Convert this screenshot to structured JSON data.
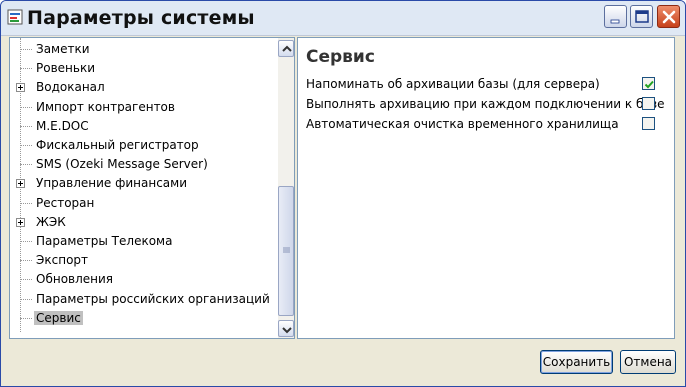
{
  "window": {
    "title": "Параметры системы"
  },
  "tree": {
    "items": [
      {
        "label": "Заметки",
        "expandable": false,
        "selected": false
      },
      {
        "label": "Ровеньки",
        "expandable": false,
        "selected": false
      },
      {
        "label": "Водоканал",
        "expandable": true,
        "selected": false
      },
      {
        "label": "Импорт контрагентов",
        "expandable": false,
        "selected": false
      },
      {
        "label": "M.E.DOC",
        "expandable": false,
        "selected": false
      },
      {
        "label": "Фискальный регистратор",
        "expandable": false,
        "selected": false
      },
      {
        "label": "SMS (Ozeki Message Server)",
        "expandable": false,
        "selected": false
      },
      {
        "label": "Управление финансами",
        "expandable": true,
        "selected": false
      },
      {
        "label": "Ресторан",
        "expandable": false,
        "selected": false
      },
      {
        "label": "ЖЭК",
        "expandable": true,
        "selected": false
      },
      {
        "label": "Параметры Телекома",
        "expandable": false,
        "selected": false
      },
      {
        "label": "Экспорт",
        "expandable": false,
        "selected": false
      },
      {
        "label": "Обновления",
        "expandable": false,
        "selected": false
      },
      {
        "label": "Параметры российских организаций",
        "expandable": false,
        "selected": false
      },
      {
        "label": "Сервис",
        "expandable": false,
        "selected": true
      }
    ]
  },
  "panel": {
    "title": "Сервис",
    "options": [
      {
        "label": "Напоминать об архивации базы (для сервера)",
        "checked": true
      },
      {
        "label": "Выполнять архивацию при каждом подключении к базе",
        "checked": false
      },
      {
        "label": "Автоматическая очистка временного хранилища",
        "checked": false
      }
    ]
  },
  "buttons": {
    "save": "Сохранить",
    "cancel": "Отмена"
  }
}
